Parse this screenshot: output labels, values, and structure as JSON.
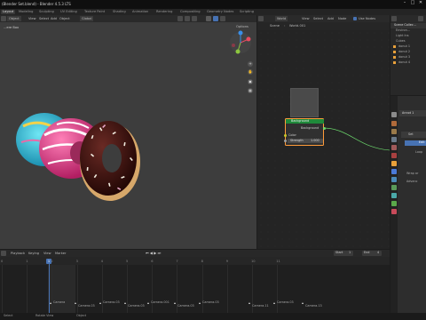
{
  "window": {
    "title": "(Blender Set.blend) - Blender 4.5.3 LTS",
    "controls": [
      "–",
      "□",
      "✕"
    ]
  },
  "workspace_tabs": [
    "Layout",
    "Modeling",
    "Sculpting",
    "UV Editing",
    "Texture Paint",
    "Shading",
    "Animation",
    "Rendering",
    "Compositing",
    "Geometry Nodes",
    "Scripting"
  ],
  "active_tab": "Layout",
  "viewport": {
    "mode": "Object",
    "header_items": [
      "View",
      "Select",
      "Add",
      "Object"
    ],
    "orientation": "Global",
    "options_label": "Options",
    "camera_label": "...ere Box"
  },
  "node_editor": {
    "editor_type": "World",
    "header_items": [
      "View",
      "Select",
      "Add",
      "Node"
    ],
    "use_nodes_label": "Use Nodes",
    "breadcrumb": [
      "Scene",
      "World.001"
    ],
    "node": {
      "title": "Background",
      "output": "Background",
      "inputs": [
        {
          "name": "Color"
        },
        {
          "name": "Strength",
          "value": "1.000"
        }
      ]
    }
  },
  "outliner": {
    "items": [
      "Scene Collec...",
      "Environ...",
      "Light Ins",
      "Cubes",
      "donut 1",
      "donut 2",
      "donut 3",
      "donut 4"
    ]
  },
  "properties": {
    "object_name": "Annot 1",
    "rows": [
      "Set",
      "Edit",
      "Loop",
      "Wrap ar",
      "Advanc"
    ]
  },
  "timeline": {
    "header_items": [
      "Playback",
      "Keying",
      "View",
      "Marker"
    ],
    "start_label": "Start",
    "start_value": "1",
    "end_label": "End",
    "end_value": "4",
    "current_frame": "1",
    "ticks": [
      "0",
      "1",
      "2",
      "3",
      "4",
      "5",
      "6",
      "7",
      "8",
      "9",
      "10",
      "11"
    ],
    "markers": [
      "Camera",
      "Camera.03",
      "Camera.03",
      "Camera.03",
      "Camera.001",
      "Camera.03",
      "Camera.03",
      "Camera.11",
      "Camera.03",
      "Camera.13"
    ]
  },
  "status": {
    "items": [
      "Select",
      "Rotate View",
      "Object"
    ]
  },
  "colors": {
    "accent": "#4772b3",
    "node_header": "#1f8a3a",
    "donut_pink": "#e8428c",
    "donut_chocolate": "#3a1210",
    "donut_blue": "#3cc7e0"
  }
}
